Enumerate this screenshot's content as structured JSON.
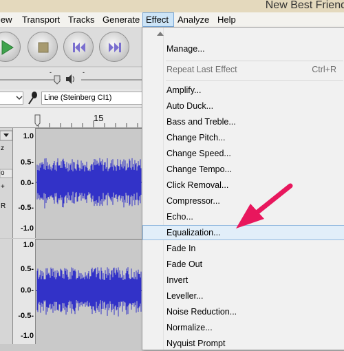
{
  "window": {
    "title": "New Best Friend"
  },
  "menubar": {
    "items": [
      {
        "label": "iew",
        "name": "menu-view"
      },
      {
        "label": "Transport",
        "name": "menu-transport"
      },
      {
        "label": "Tracks",
        "name": "menu-tracks"
      },
      {
        "label": "Generate",
        "name": "menu-generate"
      },
      {
        "label": "Effect",
        "name": "menu-effect"
      },
      {
        "label": "Analyze",
        "name": "menu-analyze"
      },
      {
        "label": "Help",
        "name": "menu-help"
      }
    ]
  },
  "transport": {
    "buttons": [
      "play-icon",
      "stop-icon",
      "skip-to-start-icon",
      "skip-to-end-icon"
    ],
    "colors": {
      "play": "#3fa34d",
      "stop": "#a79a6f",
      "skip": "#7a6fcf"
    }
  },
  "device": {
    "input_label": "Line (Steinberg CI1)",
    "icons": [
      "microphone-icon",
      "speaker-icon"
    ]
  },
  "ruler": {
    "tick_label": "15"
  },
  "tracks": [
    {
      "labels": [
        "1.0",
        "0.5-",
        "0.0-",
        "-0.5-",
        "-1.0"
      ]
    },
    {
      "labels": [
        "1.0",
        "0.5-",
        "0.0-",
        "-0.5-",
        "-1.0"
      ]
    }
  ],
  "track_controls": {
    "mute_label": "o",
    "pan_plus": "+",
    "pan_r": "R",
    "z_label": "z"
  },
  "effect_menu": {
    "items": [
      {
        "label": "Manage...",
        "name": "menu-item-manage"
      },
      {
        "label": "Repeat Last Effect",
        "shortcut": "Ctrl+R",
        "disabled": true,
        "name": "menu-item-repeat-last-effect"
      },
      {
        "label": "Amplify...",
        "name": "menu-item-amplify"
      },
      {
        "label": "Auto Duck...",
        "name": "menu-item-auto-duck"
      },
      {
        "label": "Bass and Treble...",
        "name": "menu-item-bass-and-treble"
      },
      {
        "label": "Change Pitch...",
        "name": "menu-item-change-pitch"
      },
      {
        "label": "Change Speed...",
        "name": "menu-item-change-speed"
      },
      {
        "label": "Change Tempo...",
        "name": "menu-item-change-tempo"
      },
      {
        "label": "Click Removal...",
        "name": "menu-item-click-removal"
      },
      {
        "label": "Compressor...",
        "name": "menu-item-compressor"
      },
      {
        "label": "Echo...",
        "name": "menu-item-echo"
      },
      {
        "label": "Equalization...",
        "name": "menu-item-equalization",
        "highlighted": true
      },
      {
        "label": "Fade In",
        "name": "menu-item-fade-in"
      },
      {
        "label": "Fade Out",
        "name": "menu-item-fade-out"
      },
      {
        "label": "Invert",
        "name": "menu-item-invert"
      },
      {
        "label": "Leveller...",
        "name": "menu-item-leveller"
      },
      {
        "label": "Noise Reduction...",
        "name": "menu-item-noise-reduction"
      },
      {
        "label": "Normalize...",
        "name": "menu-item-normalize"
      },
      {
        "label": "Nyquist Prompt",
        "name": "menu-item-nyquist-prompt"
      }
    ]
  },
  "annotation": {
    "arrow_color": "#e8175d",
    "icon": "pointer-arrow-icon"
  },
  "waveform_color": "#3232c8"
}
